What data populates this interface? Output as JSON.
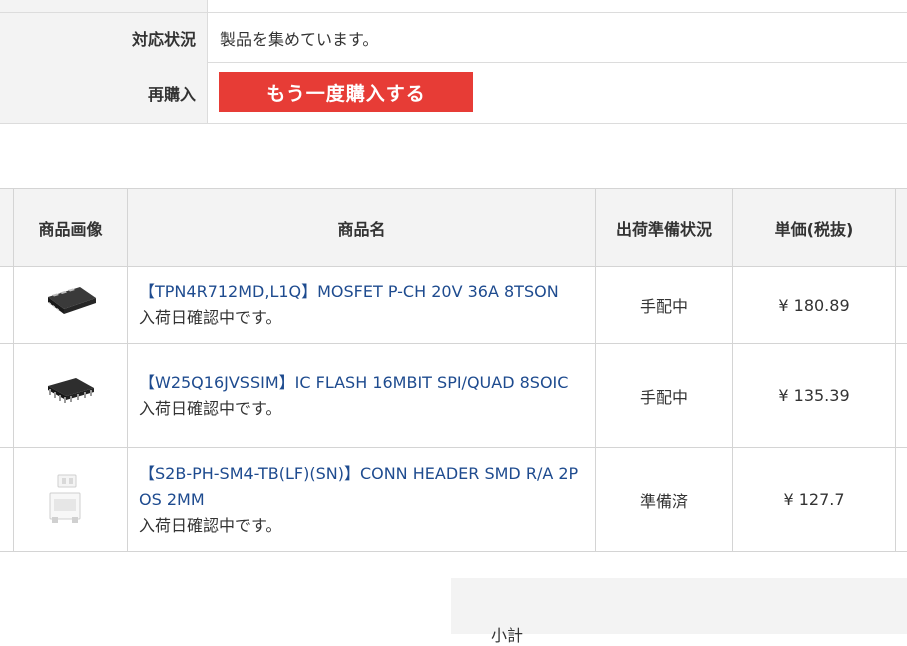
{
  "order_info": {
    "status_label": "対応状況",
    "status_value": "製品を集めています。",
    "rebuy_label": "再購入",
    "rebuy_button": "もう一度購入する"
  },
  "items_table": {
    "headers": {
      "image": "商品画像",
      "name": "商品名",
      "shipping": "出荷準備状況",
      "unit_price": "単価(税抜)"
    },
    "rows": [
      {
        "image_icon": "chip-8tson-icon",
        "name": "【TPN4R712MD,L1Q】MOSFET P-CH 20V 36A 8TSON",
        "note": "入荷日確認中です。",
        "shipping": "手配中",
        "price": "¥ 180.89"
      },
      {
        "image_icon": "chip-8soic-icon",
        "name": "【W25Q16JVSSIM】IC FLASH 16MBIT SPI/QUAD 8SOIC",
        "note": "入荷日確認中です。",
        "shipping": "手配中",
        "price": "¥ 135.39"
      },
      {
        "image_icon": "connector-header-icon",
        "name": "【S2B-PH-SM4-TB(LF)(SN)】CONN HEADER SMD R/A 2POS 2MM",
        "note": "入荷日確認中です。",
        "shipping": "準備済",
        "price": "¥ 127.7"
      }
    ]
  },
  "summary": {
    "subtotal_label": "小計"
  },
  "colors": {
    "accent_red": "#e73c36",
    "link_blue": "#1e4b8f",
    "header_bg": "#f3f3f3"
  }
}
